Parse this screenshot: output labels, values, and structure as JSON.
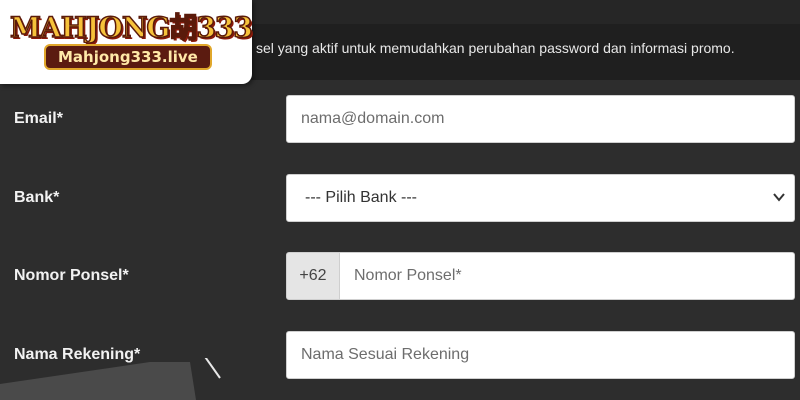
{
  "brand": {
    "logo_text": "MAHJONG胡333",
    "domain_badge": "Mahjong333.live"
  },
  "notice": {
    "text": "sel yang aktif untuk memudahkan perubahan password dan informasi promo."
  },
  "form": {
    "email": {
      "label": "Email*",
      "placeholder": "nama@domain.com"
    },
    "bank": {
      "label": "Bank*",
      "selected": "--- Pilih Bank ---"
    },
    "phone": {
      "label": "Nomor Ponsel*",
      "prefix": "+62",
      "placeholder": "Nomor Ponsel*"
    },
    "account_name": {
      "label": "Nama Rekening*",
      "placeholder": "Nama Sesuai Rekening"
    }
  },
  "colors": {
    "background": "#2d2d2d",
    "notice_bar": "#1f1f1f",
    "field_bg": "#ffffff",
    "prefix_bg": "#e5e5e5",
    "logo_gold": "#f6c23a",
    "logo_maroon": "#5b1b10"
  },
  "icons": {
    "select_arrow": "chevron-down-icon"
  }
}
